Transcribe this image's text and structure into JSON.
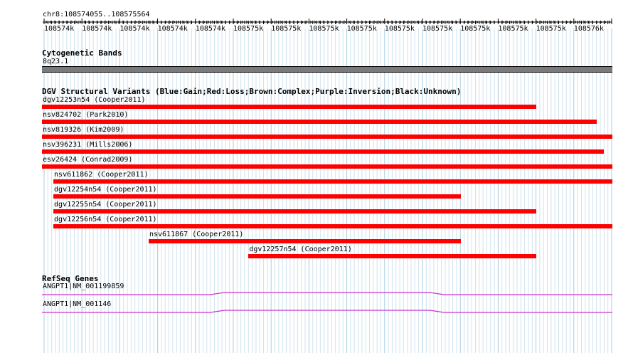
{
  "coordinates": "chr8:108574055..108575564",
  "ruler_ticks": [
    "108574k",
    "108574k",
    "108574k",
    "108574k",
    "108574k",
    "108575k",
    "108575k",
    "108575k",
    "108575k",
    "108575k",
    "108575k",
    "108575k",
    "108575k",
    "108575k",
    "108576k"
  ],
  "cytobands": {
    "title": "Cytogenetic Bands",
    "band": "8q23.1",
    "color": "#7a7a7a"
  },
  "dgv": {
    "title": "DGV Structural Variants (Blue:Gain;Red:Loss;Brown:Complex;Purple:Inversion;Black:Unknown)",
    "loss_color": "#ff0000",
    "variants": [
      {
        "label": "dgv12253n54 (Cooper2011)",
        "start": 0.0,
        "end": 0.866
      },
      {
        "label": "nsv824702 (Park2010)",
        "start": 0.0,
        "end": 0.972
      },
      {
        "label": "nsv819326 (Kim2009)",
        "start": 0.0,
        "end": 1.0
      },
      {
        "label": "nsv396231 (Mills2006)",
        "start": 0.0,
        "end": 0.985
      },
      {
        "label": "esv26424 (Conrad2009)",
        "start": 0.0,
        "end": 1.0
      },
      {
        "label": "nsv611862 (Cooper2011)",
        "start": 0.02,
        "end": 1.0
      },
      {
        "label": "dgv12254n54 (Cooper2011)",
        "start": 0.02,
        "end": 0.735
      },
      {
        "label": "dgv12255n54 (Cooper2011)",
        "start": 0.02,
        "end": 0.866
      },
      {
        "label": "dgv12256n54 (Cooper2011)",
        "start": 0.02,
        "end": 1.0
      },
      {
        "label": "nsv611867 (Cooper2011)",
        "start": 0.187,
        "end": 0.735
      },
      {
        "label": "dgv12257n54 (Cooper2011)",
        "start": 0.362,
        "end": 0.866
      }
    ]
  },
  "refseq": {
    "title": "RefSeq Genes",
    "color": "#cc33cc",
    "genes": [
      {
        "label": "ANGPT1|NM_001199859"
      },
      {
        "label": "ANGPT1|NM_001146"
      }
    ]
  }
}
